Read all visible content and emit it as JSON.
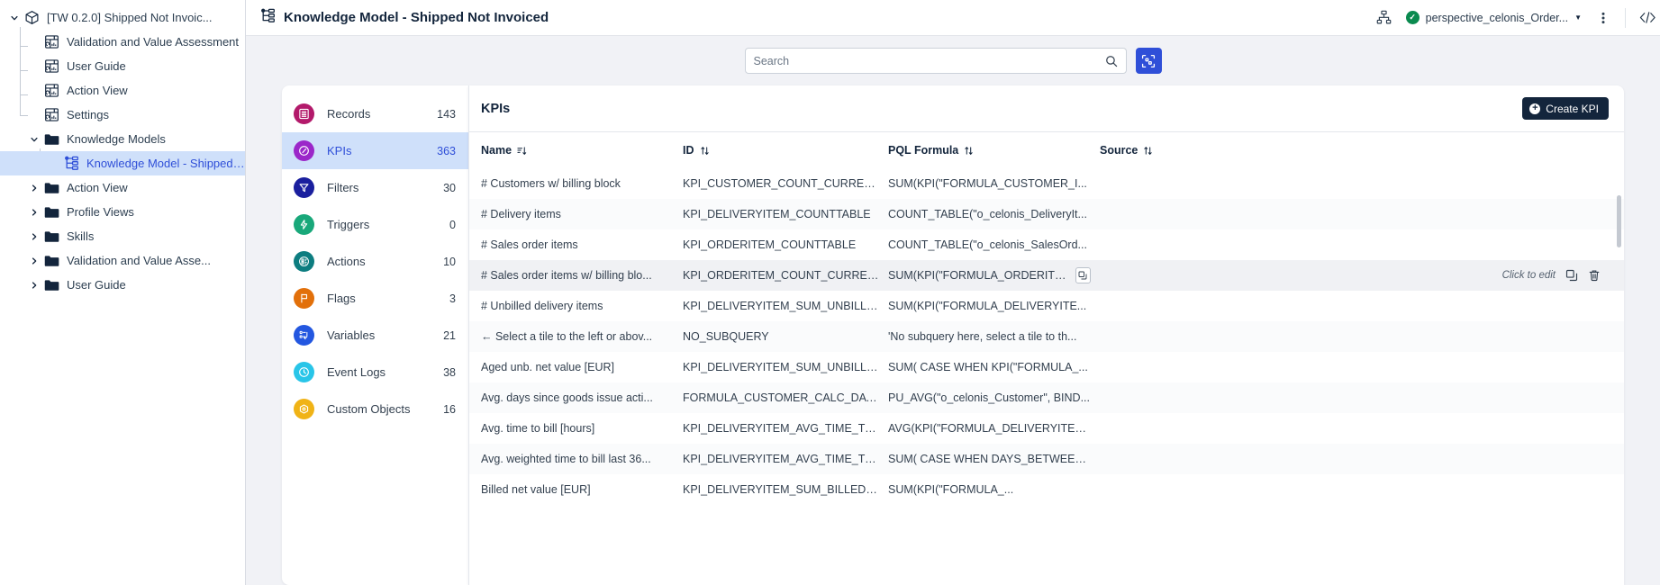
{
  "explorer": {
    "items": [
      {
        "label": "[TW 0.2.0] Shipped Not Invoic...",
        "icon": "package-icon",
        "indent": 1,
        "chevron": "down",
        "type": "package",
        "selected": false
      },
      {
        "label": "Validation and Value Assessment",
        "icon": "view-icon",
        "indent": 2,
        "chevron": "none",
        "type": "view",
        "selected": false
      },
      {
        "label": "User Guide",
        "icon": "view-icon",
        "indent": 2,
        "chevron": "none",
        "type": "view",
        "selected": false
      },
      {
        "label": "Action View",
        "icon": "view-icon",
        "indent": 2,
        "chevron": "none",
        "type": "view",
        "selected": false
      },
      {
        "label": "Settings",
        "icon": "view-icon",
        "indent": 2,
        "chevron": "none",
        "type": "view",
        "selected": false
      },
      {
        "label": "Knowledge Models",
        "icon": "folder-icon",
        "indent": 2,
        "chevron": "down",
        "type": "folder",
        "selected": false
      },
      {
        "label": "Knowledge Model - Shipped ...",
        "icon": "knowledge-model-icon",
        "indent": 3,
        "chevron": "none",
        "type": "km",
        "selected": true
      },
      {
        "label": "Action View",
        "icon": "folder-icon",
        "indent": 2,
        "chevron": "right",
        "type": "folder",
        "selected": false
      },
      {
        "label": "Profile Views",
        "icon": "folder-icon",
        "indent": 2,
        "chevron": "right",
        "type": "folder",
        "selected": false
      },
      {
        "label": "Skills",
        "icon": "folder-icon",
        "indent": 2,
        "chevron": "right",
        "type": "folder",
        "selected": false
      },
      {
        "label": "Validation and Value Asse...",
        "icon": "folder-icon",
        "indent": 2,
        "chevron": "right",
        "type": "folder",
        "selected": false
      },
      {
        "label": "User Guide",
        "icon": "folder-icon",
        "indent": 2,
        "chevron": "right",
        "type": "folder",
        "selected": false
      }
    ]
  },
  "topbar": {
    "title": "Knowledge Model - Shipped Not Invoiced",
    "title_icon": "knowledge-model-icon",
    "hierarchy_icon": "hierarchy-icon",
    "perspective_label": "perspective_celonis_Order...",
    "perspective_status": "valid",
    "dropdown_icon": "chevron-down-icon",
    "more_icon": "kebab-menu-icon",
    "code_icon": "code-icon"
  },
  "search": {
    "placeholder": "Search",
    "value": "",
    "icon": "search-icon",
    "action_icon": "scan-icon"
  },
  "nav": {
    "items": [
      {
        "label": "Records",
        "count": "143",
        "icon": "records-icon",
        "color": "#b31a6b",
        "active": false
      },
      {
        "label": "KPIs",
        "count": "363",
        "icon": "kpis-icon",
        "color": "#9b27c9",
        "active": true
      },
      {
        "label": "Filters",
        "count": "30",
        "icon": "filter-icon",
        "color": "#1a1f9e",
        "active": false
      },
      {
        "label": "Triggers",
        "count": "0",
        "icon": "trigger-icon",
        "color": "#19a87a",
        "active": false
      },
      {
        "label": "Actions",
        "count": "10",
        "icon": "actions-icon",
        "color": "#0d7d80",
        "active": false
      },
      {
        "label": "Flags",
        "count": "3",
        "icon": "flag-icon",
        "color": "#e2700a",
        "active": false
      },
      {
        "label": "Variables",
        "count": "21",
        "icon": "variables-icon",
        "color": "#2357e0",
        "active": false
      },
      {
        "label": "Event Logs",
        "count": "38",
        "icon": "event-logs-icon",
        "color": "#29c5e8",
        "active": false
      },
      {
        "label": "Custom Objects",
        "count": "16",
        "icon": "custom-objects-icon",
        "color": "#f0b316",
        "active": false
      }
    ]
  },
  "kpi_panel": {
    "title": "KPIs",
    "create_label": "Create KPI",
    "create_icon": "plus-icon",
    "columns": [
      {
        "label": "Name",
        "sort": "desc",
        "sort_icon": "sort-desc-icon"
      },
      {
        "label": "ID",
        "sort": "none",
        "sort_icon": "sort-icon"
      },
      {
        "label": "PQL Formula",
        "sort": "none",
        "sort_icon": "sort-icon"
      },
      {
        "label": "Source",
        "sort": "none",
        "sort_icon": "sort-icon"
      }
    ],
    "row_hover": {
      "hint": "Click to edit",
      "copy_icon": "copy-icon",
      "duplicate_icon": "duplicate-icon",
      "delete_icon": "trash-icon"
    },
    "rows": [
      {
        "name": "# Customers w/ billing block",
        "id": "KPI_CUSTOMER_COUNT_CURRENT_...",
        "pql": "SUM(KPI(\"FORMULA_CUSTOMER_I...",
        "source": ""
      },
      {
        "name": "# Delivery items",
        "id": "KPI_DELIVERYITEM_COUNTTABLE",
        "pql": "COUNT_TABLE(\"o_celonis_DeliveryIt...",
        "source": ""
      },
      {
        "name": "# Sales order items",
        "id": "KPI_ORDERITEM_COUNTTABLE",
        "pql": "COUNT_TABLE(\"o_celonis_SalesOrd...",
        "source": ""
      },
      {
        "name": "# Sales order items w/ billing blo...",
        "id": "KPI_ORDERITEM_COUNT_CURRENT_...",
        "pql": "SUM(KPI(\"FORMULA_ORDERITEM...",
        "source": ""
      },
      {
        "name": "# Unbilled delivery items",
        "id": "KPI_DELIVERYITEM_SUM_UNBILLED",
        "pql": "SUM(KPI(\"FORMULA_DELIVERYITE...",
        "source": ""
      },
      {
        "name": "← Select a tile to the left or abov...",
        "id": "NO_SUBQUERY",
        "pql": "'No subquery here, select a tile to th...",
        "source": ""
      },
      {
        "name": "Aged unb. net value [EUR]",
        "id": "KPI_DELIVERYITEM_SUM_UNBILLED...",
        "pql": "SUM( CASE WHEN KPI(\"FORMULA_...",
        "source": ""
      },
      {
        "name": "Avg. days since goods issue acti...",
        "id": "FORMULA_CUSTOMER_CALC_DAYS...",
        "pql": "PU_AVG(\"o_celonis_Customer\", BIND...",
        "source": ""
      },
      {
        "name": "Avg. time to bill [hours]",
        "id": "KPI_DELIVERYITEM_AVG_TIME_TO_B...",
        "pql": "AVG(KPI(\"FORMULA_DELIVERYITEM...",
        "source": ""
      },
      {
        "name": "Avg. weighted time to bill last 36...",
        "id": "KPI_DELIVERYITEM_AVG_TIME_TO_B...",
        "pql": "SUM( CASE WHEN DAYS_BETWEEN...",
        "source": ""
      },
      {
        "name": "Billed net value [EUR]",
        "id": "KPI_DELIVERYITEM_SUM_BILLED_R...",
        "pql": "SUM(KPI(\"FORMULA_...",
        "source": ""
      }
    ]
  }
}
